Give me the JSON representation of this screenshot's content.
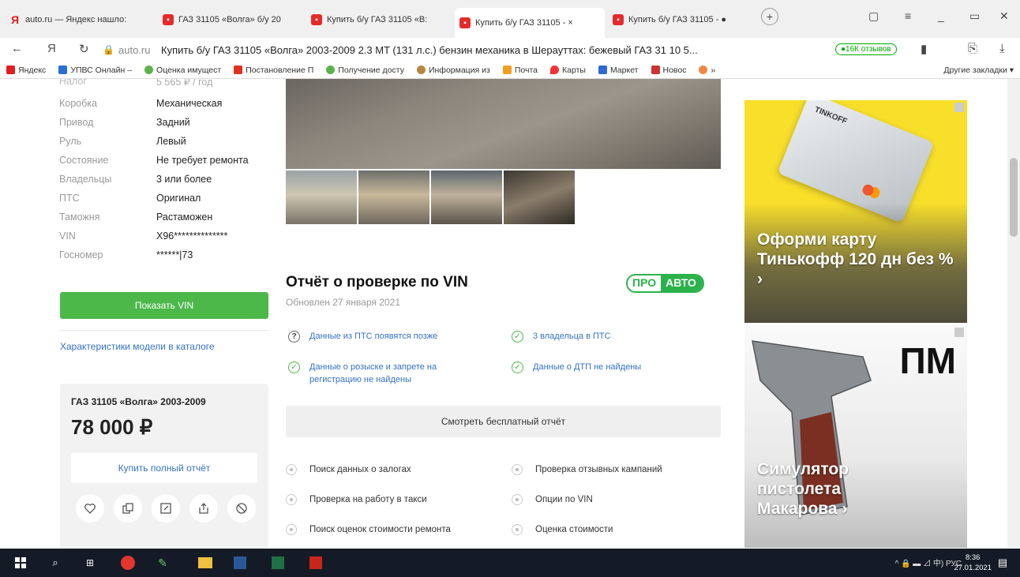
{
  "browser": {
    "tabs": [
      {
        "title": "auto.ru — Яндекс нашло:",
        "active": false
      },
      {
        "title": "ГАЗ 31105 «Волга» б/у 20",
        "active": false
      },
      {
        "title": "Купить б/у ГАЗ 31105 «В:",
        "active": false
      },
      {
        "title": "Купить б/у ГАЗ 31105 - ×",
        "active": true
      },
      {
        "title": "Купить б/у ГАЗ 31105 - ●",
        "active": false
      }
    ],
    "url_domain": "auto.ru",
    "url_title": "Купить б/у ГАЗ 31105 «Волга» 2003-2009 2.3 MT (131 л.с.) бензин механика в Шерауттах: бежевый ГАЗ 31 10 5...",
    "reviews_badge": "●16К отзывов",
    "bookmarks": [
      "Яндекс",
      "УПВС Онлайн – ",
      "Оценка имущест",
      "Постановление П",
      "Получение досту",
      "Информация из ",
      "Почта",
      "Карты",
      "Маркет",
      "Новос",
      "»",
      "Другие закладки ▾"
    ]
  },
  "specs": {
    "rows": [
      {
        "k": "Коробка",
        "v": "Механическая"
      },
      {
        "k": "Привод",
        "v": "Задний"
      },
      {
        "k": "Руль",
        "v": "Левый"
      },
      {
        "k": "Состояние",
        "v": "Не требует ремонта"
      },
      {
        "k": "Владельцы",
        "v": "3 или более"
      },
      {
        "k": "ПТС",
        "v": "Оригинал"
      },
      {
        "k": "Таможня",
        "v": "Растаможен"
      },
      {
        "k": "VIN",
        "v": "X96**************"
      },
      {
        "k": "Госномер",
        "v": "******|73"
      }
    ],
    "show_vin": "Показать VIN",
    "catalog_link": "Характеристики модели в каталоге"
  },
  "price_card": {
    "car": "ГАЗ 31105 «Волга» 2003-2009",
    "price": "78 000 ₽",
    "buy_report": "Купить полный отчёт"
  },
  "vin_report": {
    "title": "Отчёт о проверке по VIN",
    "updated": "Обновлен 27 января 2021",
    "badge_pro": "ПРО",
    "badge_auto": "АВТО",
    "checks": [
      {
        "text": "Данные из ПТС появятся позже",
        "status": "pending"
      },
      {
        "text": "3 владельца в ПТС",
        "status": "ok"
      },
      {
        "text": "Данные о розыске и запрете на регистрацию не найдены",
        "status": "ok"
      },
      {
        "text": "Данные о ДТП не найдены",
        "status": "ok"
      }
    ],
    "free_report": "Смотреть бесплатный отчёт",
    "features": [
      "Поиск данных о залогах",
      "Проверка отзывных кампаний",
      "Проверка на работу в такси",
      "Опции по VIN",
      "Поиск оценок стоимости ремонта",
      "Оценка стоимости"
    ]
  },
  "ads": {
    "ad1_text": "Оформи карту Тинькофф 120 дн без % ›",
    "ad1_brand": "TINKOFF",
    "ad2_text": "Симулятор пистолета Макарова ›",
    "ad2_logo": "ПМ"
  },
  "taskbar": {
    "tray": "^ 🔒 ▬ ⊿ 中) РУС",
    "time": "8:36",
    "date": "27.01.2021"
  },
  "colors": {
    "green": "#4cb84a",
    "link": "#3571c5",
    "ad_yellow": "#f8df2a"
  }
}
